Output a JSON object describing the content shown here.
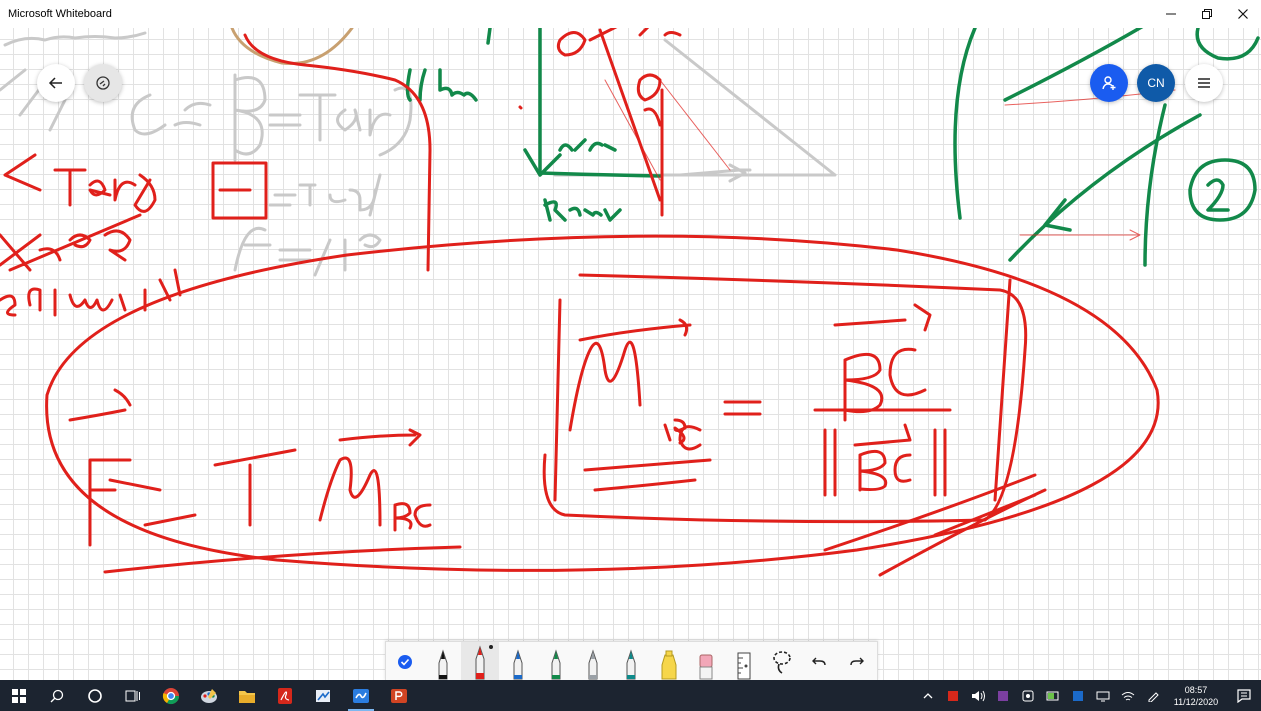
{
  "window": {
    "title": "Microsoft Whiteboard",
    "minimize_icon": "minimize-icon",
    "maximize_icon": "restore-icon",
    "close_icon": "close-icon"
  },
  "header": {
    "back_icon": "arrow-left-icon",
    "share_icon": "share-link-icon",
    "invite_icon": "add-person-icon",
    "avatar_initials": "CN",
    "menu_icon": "hamburger-icon"
  },
  "colors": {
    "ink_red": "#e0201b",
    "ink_green": "#12894a",
    "ink_gray": "#c9c9c9",
    "ink_brown": "#c8a070",
    "accent_blue": "#1a5cf0",
    "avatar_blue": "#0f5aa8",
    "taskbar": "#1c2430"
  },
  "toolbar": {
    "tools": [
      {
        "name": "check",
        "icon": "checkmark-icon"
      },
      {
        "name": "black-pen",
        "icon": "pen-icon",
        "color": "#111111"
      },
      {
        "name": "red-pen",
        "icon": "pen-icon",
        "color": "#e0201b",
        "selected": true
      },
      {
        "name": "blue-pen",
        "icon": "pen-icon",
        "color": "#1b6ac9"
      },
      {
        "name": "green-pen",
        "icon": "pen-icon",
        "color": "#12894a"
      },
      {
        "name": "gray-pen",
        "icon": "pen-icon",
        "color": "#9aa0a6"
      },
      {
        "name": "teal-pen",
        "icon": "pen-icon",
        "color": "#0e8a8a"
      },
      {
        "name": "highlighter",
        "icon": "highlighter-icon",
        "color": "#f6d64a"
      },
      {
        "name": "eraser",
        "icon": "eraser-icon",
        "color": "#f2a7b8"
      },
      {
        "name": "ruler",
        "icon": "ruler-icon"
      },
      {
        "name": "lasso",
        "icon": "lasso-icon"
      },
      {
        "name": "undo",
        "icon": "undo-icon"
      },
      {
        "name": "redo",
        "icon": "redo-icon"
      }
    ]
  },
  "taskbar": {
    "start_icon": "windows-logo-icon",
    "search_icon": "search-icon",
    "cortana_icon": "cortana-circle-icon",
    "taskview_icon": "task-view-icon",
    "apps": [
      "chrome-icon",
      "paint-icon",
      "file-explorer-icon",
      "acrobat-icon",
      "snip-icon",
      "whiteboard-icon",
      "powerpoint-icon"
    ],
    "tray_icons": [
      "chevron-up-icon",
      "app-tray-icon",
      "volume-icon",
      "onenote-tray-icon",
      "tray-app-icon",
      "battery-icon",
      "display-icon",
      "network-icon",
      "wifi-icon",
      "pen-tray-icon"
    ],
    "time": "08:57",
    "date": "11/12/2020",
    "notification_icon": "notification-icon"
  }
}
